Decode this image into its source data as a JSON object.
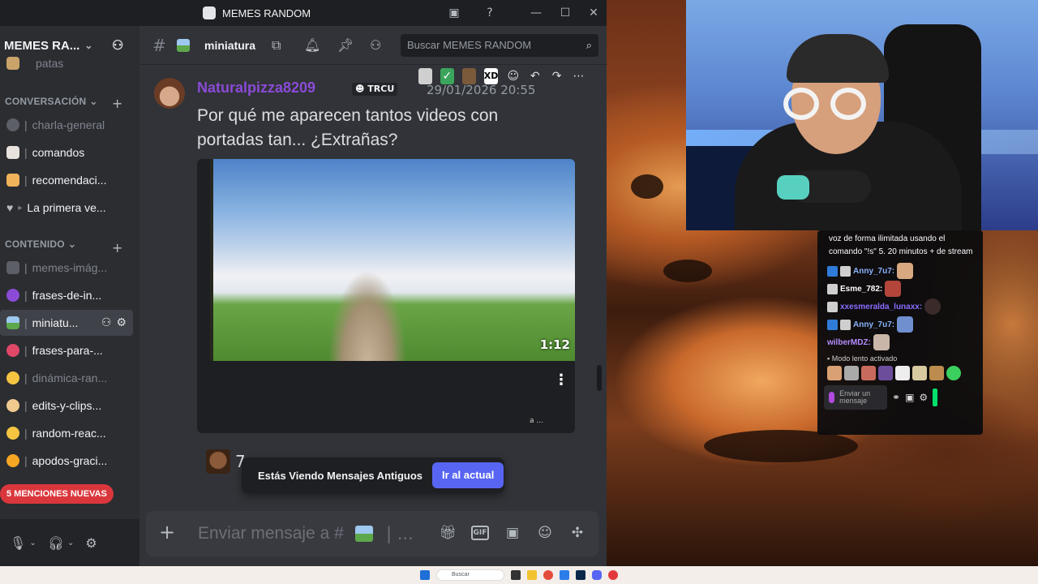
{
  "window": {
    "title": "MEMES RANDOM",
    "controls": [
      "minimize",
      "maximize",
      "close"
    ]
  },
  "server": {
    "name": "MEMES RA..."
  },
  "sidebar": {
    "partial_top_item": "patas",
    "categories": [
      {
        "label": "CONVERSACIÓN"
      },
      {
        "label": "CONTENIDO"
      }
    ],
    "channels": [
      {
        "label": "charla-general",
        "muted": true
      },
      {
        "label": "comandos",
        "muted": false
      },
      {
        "label": "recomendaci...",
        "muted": false
      },
      {
        "label": "La primera ve...",
        "muted": false
      },
      {
        "label": "memes-imág...",
        "muted": true
      },
      {
        "label": "frases-de-in...",
        "muted": false
      },
      {
        "label": "miniatu...",
        "muted": false,
        "active": true
      },
      {
        "label": "frases-para-...",
        "muted": false
      },
      {
        "label": "dinámica-ran...",
        "muted": true
      },
      {
        "label": "edits-y-clips...",
        "muted": false
      },
      {
        "label": "random-reac...",
        "muted": false
      },
      {
        "label": "apodos-graci...",
        "muted": false
      }
    ],
    "mentions_pill": "5 MENCIONES NUEVAS"
  },
  "channel_header": {
    "name": "miniatura",
    "search_placeholder": "Buscar MEMES RANDOM"
  },
  "message": {
    "author": "Naturalpizza8209",
    "tag": "TRCU",
    "timestamp": "29/01/2026 20:55",
    "text": "Por qué me aparecen tantos videos con portadas tan... ¿Extrañas?",
    "video_duration": "1:12",
    "video_footer": "a ..."
  },
  "reaction": {
    "count": "7"
  },
  "old_messages_bar": {
    "text": "Estás Viendo Mensajes Antiguos",
    "button": "Ir al actual"
  },
  "composer": {
    "placeholder": "Enviar mensaje a #",
    "placeholder_tail": "| ...",
    "icons": [
      "gift-icon",
      "gif-icon",
      "sticker-icon",
      "emoji-icon",
      "apps-icon"
    ],
    "gif_label": "GIF"
  },
  "stream_chat": {
    "intro": "voz de forma ilimitada usando el comando \"!s\" 5. 20 minutos + de stream",
    "messages": [
      {
        "user": "Anny_7u7:",
        "color": "#8ab4ff"
      },
      {
        "user": "Esme_782:",
        "color": "#ffffff"
      },
      {
        "user": "xxesmeralda_lunaxx:",
        "color": "#8b6cff"
      },
      {
        "user": "Anny_7u7:",
        "color": "#8ab4ff"
      },
      {
        "user": "wilberMDZ:",
        "color": "#b48cff"
      }
    ],
    "slow_mode": "Modo lento activado",
    "input_placeholder": "Enviar un mensaje"
  },
  "taskbar": {
    "search_label": "Buscar"
  },
  "colors": {
    "discord_bg": "#313338",
    "accent": "#5865f2",
    "mention_red": "#da373c",
    "author": "#8a4bd6"
  }
}
